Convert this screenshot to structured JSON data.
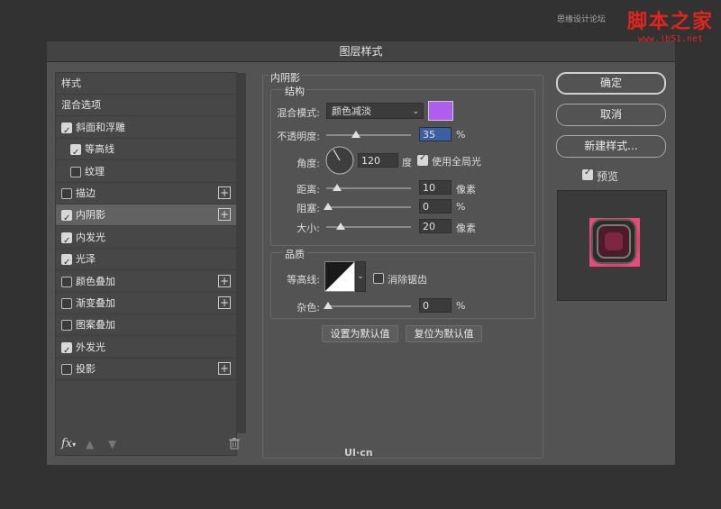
{
  "watermark": {
    "small": "思缘设计论坛",
    "big": "脚本之家",
    "url": "www.jb51.net",
    "bottom": "UI·cn"
  },
  "dialog": {
    "title": "图层样式",
    "styles_list": [
      {
        "label": "样式",
        "checkbox": false,
        "checked": false,
        "plus": false,
        "indent": 0,
        "selected": false
      },
      {
        "label": "混合选项",
        "checkbox": false,
        "checked": false,
        "plus": false,
        "indent": 0,
        "selected": false
      },
      {
        "label": "斜面和浮雕",
        "checkbox": true,
        "checked": true,
        "plus": false,
        "indent": 0,
        "selected": false
      },
      {
        "label": "等高线",
        "checkbox": true,
        "checked": true,
        "plus": false,
        "indent": 1,
        "selected": false
      },
      {
        "label": "纹理",
        "checkbox": true,
        "checked": false,
        "plus": false,
        "indent": 1,
        "selected": false
      },
      {
        "label": "描边",
        "checkbox": true,
        "checked": false,
        "plus": true,
        "indent": 0,
        "selected": false
      },
      {
        "label": "内阴影",
        "checkbox": true,
        "checked": true,
        "plus": true,
        "indent": 0,
        "selected": true
      },
      {
        "label": "内发光",
        "checkbox": true,
        "checked": true,
        "plus": false,
        "indent": 0,
        "selected": false
      },
      {
        "label": "光泽",
        "checkbox": true,
        "checked": true,
        "plus": false,
        "indent": 0,
        "selected": false
      },
      {
        "label": "颜色叠加",
        "checkbox": true,
        "checked": false,
        "plus": true,
        "indent": 0,
        "selected": false
      },
      {
        "label": "渐变叠加",
        "checkbox": true,
        "checked": false,
        "plus": true,
        "indent": 0,
        "selected": false
      },
      {
        "label": "图案叠加",
        "checkbox": true,
        "checked": false,
        "plus": false,
        "indent": 0,
        "selected": false
      },
      {
        "label": "外发光",
        "checkbox": true,
        "checked": true,
        "plus": false,
        "indent": 0,
        "selected": false
      },
      {
        "label": "投影",
        "checkbox": true,
        "checked": false,
        "plus": true,
        "indent": 0,
        "selected": false
      }
    ],
    "footer": {
      "fx_label": "fx",
      "up_icon": "arrow-up-icon",
      "down_icon": "arrow-down-icon",
      "trash_icon": "trash-icon"
    },
    "inner_shadow": {
      "section_title": "内阴影",
      "structure_title": "结构",
      "blend_mode_label": "混合模式:",
      "blend_mode_value": "颜色减淡",
      "color": "#b05cf0",
      "opacity_label": "不透明度:",
      "opacity_value": "35",
      "opacity_unit": "%",
      "opacity_fraction": 0.35,
      "angle_label": "角度:",
      "angle_value": "120",
      "angle_unit": "度",
      "global_light_label": "使用全局光",
      "global_light_checked": true,
      "distance_label": "距离:",
      "distance_value": "10",
      "distance_unit": "像素",
      "choke_label": "阻塞:",
      "choke_value": "0",
      "choke_unit": "%",
      "size_label": "大小:",
      "size_value": "20",
      "size_unit": "像素",
      "quality_title": "品质",
      "contour_label": "等高线:",
      "antialias_label": "消除锯齿",
      "antialias_checked": false,
      "noise_label": "杂色:",
      "noise_value": "0",
      "noise_unit": "%",
      "make_default_label": "设置为默认值",
      "reset_default_label": "复位为默认值"
    },
    "buttons": {
      "ok": "确定",
      "cancel": "取消",
      "new_style": "新建样式...",
      "preview_label": "预览",
      "preview_checked": true
    }
  }
}
